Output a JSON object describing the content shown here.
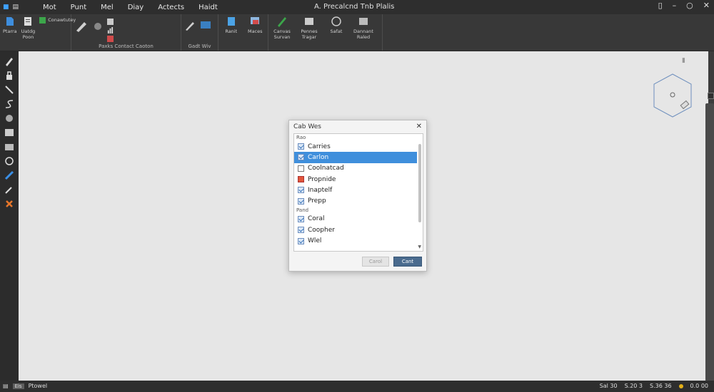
{
  "titlebar": {
    "menu": [
      "Mot",
      "Punt",
      "Mel",
      "Diay",
      "Actects",
      "Haidt"
    ],
    "title": "A. Precalcnd Tnb Plalis"
  },
  "ribbon": {
    "groups": [
      {
        "buttons": [
          "Ptarra",
          "Uatdg Poon"
        ],
        "small": [
          "Conawtutey"
        ],
        "label": ""
      },
      {
        "buttons": [],
        "small": [
          "Paaks",
          "Contact Caoion"
        ],
        "label": "Paxks    Contact Caoton"
      },
      {
        "buttons": [],
        "small": [],
        "label": "Gadt Wiv"
      },
      {
        "buttons": [
          "Ranit",
          "Maces"
        ],
        "small": [],
        "label": ""
      },
      {
        "buttons": [
          "Canvas Survan",
          "Pennes Tragar",
          "Safat",
          "Dannant Raled"
        ],
        "small": [],
        "label": ""
      }
    ]
  },
  "dialog": {
    "title": "Cab Wes",
    "groups": [
      {
        "label": "Rao",
        "items": [
          {
            "label": "Carries",
            "state": "checked",
            "selected": false
          },
          {
            "label": "Carlon",
            "state": "checked",
            "selected": true
          },
          {
            "label": "Coolnatcad",
            "state": "unchecked",
            "selected": false
          },
          {
            "label": "Propnide",
            "state": "red",
            "selected": false
          },
          {
            "label": "Inaptelf",
            "state": "checked",
            "selected": false
          },
          {
            "label": "Prepp",
            "state": "checked",
            "selected": false
          }
        ]
      },
      {
        "label": "Pand",
        "items": [
          {
            "label": "Coral",
            "state": "checked",
            "selected": false
          },
          {
            "label": "Coopher",
            "state": "checked",
            "selected": false
          },
          {
            "label": "Wlel",
            "state": "checked",
            "selected": false
          }
        ]
      }
    ],
    "cancel_label": "Carol",
    "ok_label": "Cant"
  },
  "statusbar": {
    "badge": "Eis",
    "left_text": "Ptowel",
    "right_items": [
      "Sal 30",
      "S.20 3",
      "S.36 36",
      "0.0 00"
    ]
  },
  "colors": {
    "accent": "#3f8fdc",
    "canvas": "#e6e6e6",
    "chrome": "#383838"
  }
}
